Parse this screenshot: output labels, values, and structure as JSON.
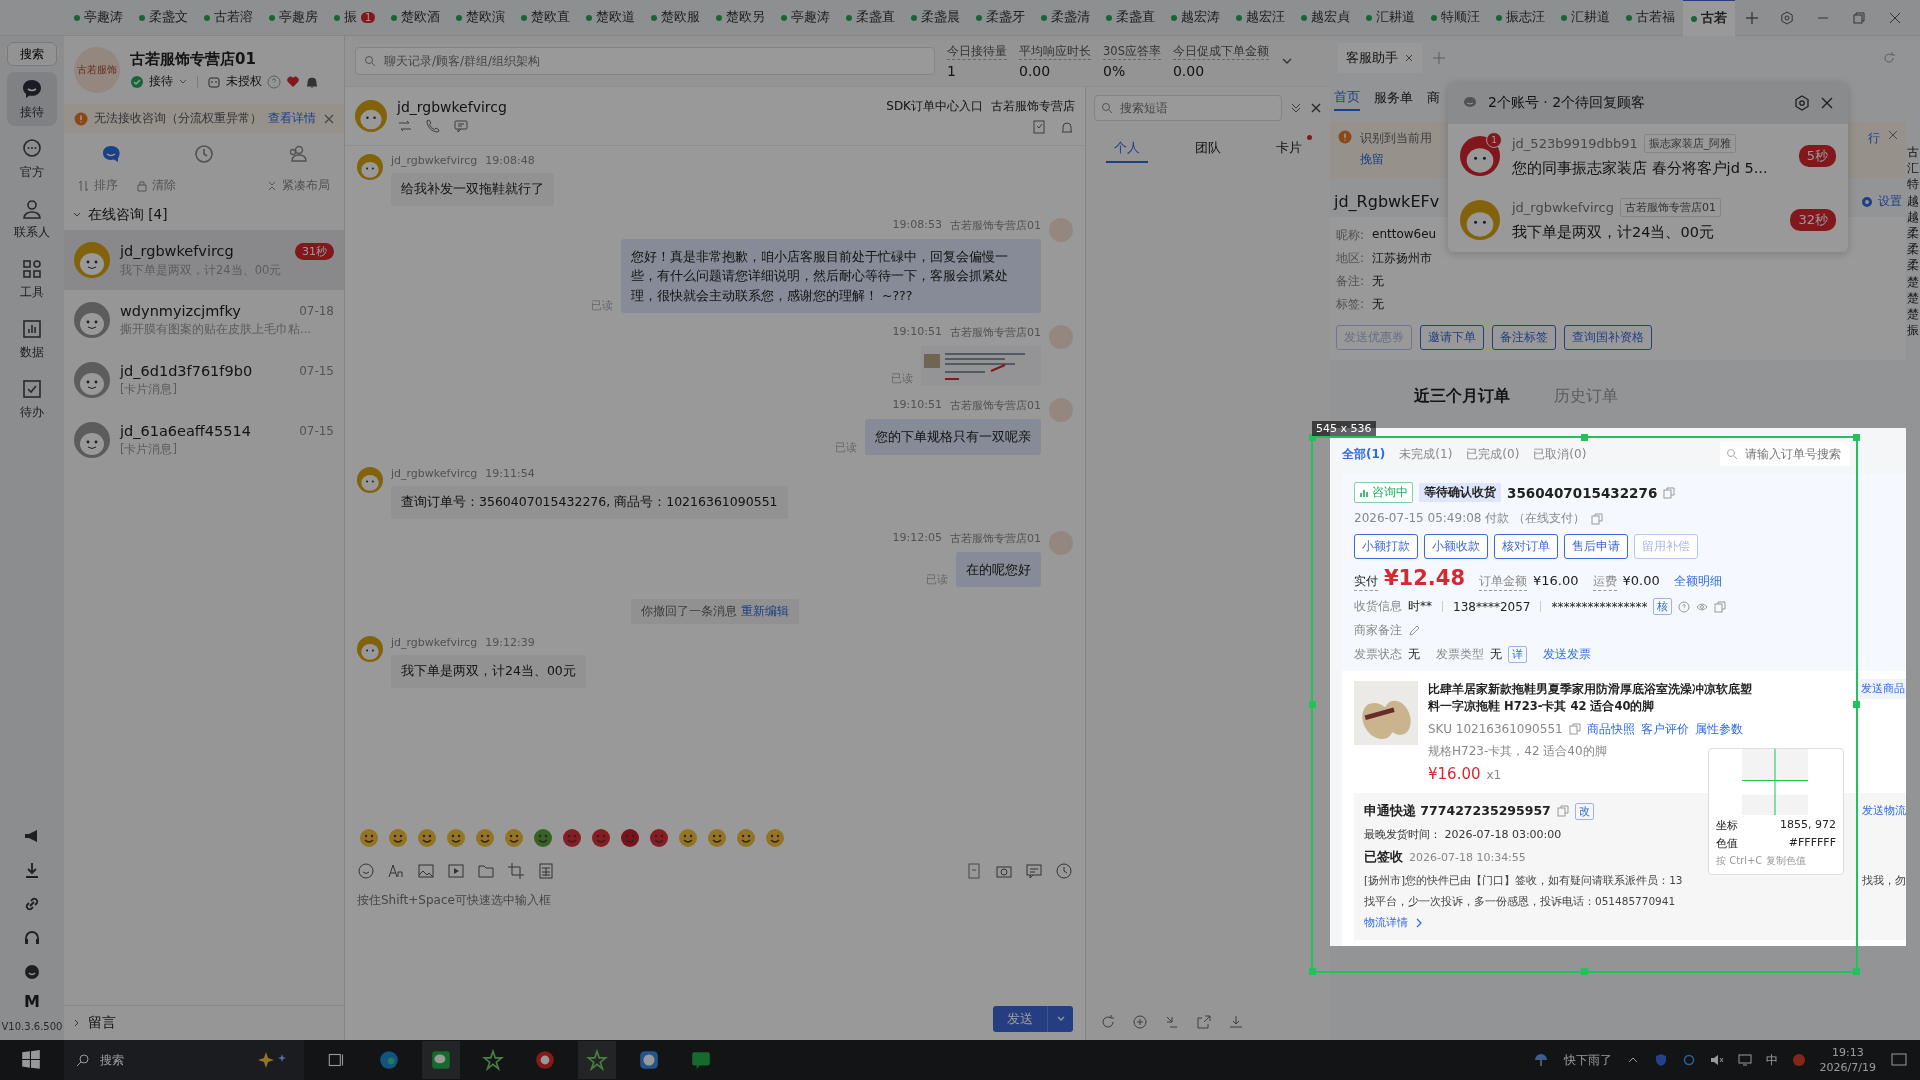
{
  "tabs": [
    {
      "label": "亭趣涛",
      "selected": false
    },
    {
      "label": "柔盏文",
      "selected": false
    },
    {
      "label": "古若溶",
      "selected": false
    },
    {
      "label": "亭趣房",
      "selected": false
    },
    {
      "label": "振",
      "badge": "1",
      "selected": false
    },
    {
      "label": "楚欧酒",
      "selected": false
    },
    {
      "label": "楚欧演",
      "selected": false
    },
    {
      "label": "楚欧直",
      "selected": false
    },
    {
      "label": "楚欧道",
      "selected": false
    },
    {
      "label": "楚欧服",
      "selected": false
    },
    {
      "label": "楚欧另",
      "selected": false
    },
    {
      "label": "亭趣涛",
      "selected": false
    },
    {
      "label": "柔盏直",
      "selected": false
    },
    {
      "label": "柔盏晨",
      "selected": false
    },
    {
      "label": "柔盏牙",
      "selected": false
    },
    {
      "label": "柔盏清",
      "selected": false
    },
    {
      "label": "柔盏直",
      "selected": false
    },
    {
      "label": "越宏涛",
      "selected": false
    },
    {
      "label": "越宏汪",
      "selected": false
    },
    {
      "label": "越宏貞",
      "selected": false
    },
    {
      "label": "汇耕道",
      "selected": false
    },
    {
      "label": "特顺汪",
      "selected": false
    },
    {
      "label": "振志汪",
      "selected": false
    },
    {
      "label": "汇耕道",
      "selected": false
    },
    {
      "label": "古若福",
      "selected": false
    },
    {
      "label": "古若",
      "selected": true
    }
  ],
  "rail": {
    "search_label": "搜索",
    "items": [
      {
        "kind": "chat",
        "label": "接待",
        "selected": true
      },
      {
        "kind": "official",
        "label": "官方",
        "selected": false
      },
      {
        "kind": "contacts",
        "label": "联系人",
        "selected": false
      },
      {
        "kind": "tools",
        "label": "工具",
        "selected": false
      },
      {
        "kind": "data",
        "label": "数据",
        "selected": false
      },
      {
        "kind": "todo",
        "label": "待办",
        "selected": false
      }
    ],
    "m_label": "M",
    "version": "V10.3.6.500"
  },
  "store": {
    "avatar_text": "古若服饰",
    "name": "古若服饰专营店01",
    "status": "接待",
    "auth": "未授权"
  },
  "alert": {
    "text": "无法接收咨询（分流权重异常）",
    "link": "查看详情"
  },
  "contact_tabs": [
    {
      "kind": "chat",
      "selected": true
    },
    {
      "kind": "history",
      "selected": false
    },
    {
      "kind": "group",
      "selected": false
    }
  ],
  "actions": [
    {
      "kind": "sort",
      "label": "排序"
    },
    {
      "kind": "clear",
      "label": "清除"
    },
    {
      "kind": "compact",
      "label": "紧凑布局"
    }
  ],
  "group": {
    "label": "在线咨询 [4]",
    "expanded": true
  },
  "contacts": [
    {
      "name": "jd_rgbwkefvircg",
      "preview": "我下单是两双，计24当、00元",
      "timer": "31秒",
      "kind": "gold",
      "selected": true
    },
    {
      "name": "wdynmyizcjmfky",
      "preview": "撕开膜有图案的贴在皮肤上毛巾粘...",
      "time": "07-18",
      "kind": "gray",
      "selected": false
    },
    {
      "name": "jd_6d1d3f761f9b0",
      "preview": "[卡片消息]",
      "time": "07-15",
      "kind": "gray",
      "selected": false
    },
    {
      "name": "jd_61a6eaff45514",
      "preview": "[卡片消息]",
      "time": "07-15",
      "kind": "gray",
      "selected": false
    }
  ],
  "footer_group": {
    "label": "留言",
    "expanded": false
  },
  "top_search": {
    "placeholder": "聊天记录/顾客/群组/组织架构"
  },
  "stats": [
    {
      "label": "今日接待量",
      "value": "1"
    },
    {
      "label": "平均响应时长",
      "value": "0.00"
    },
    {
      "label": "30S应答率",
      "value": "0%"
    },
    {
      "label": "今日促成下单金额",
      "value": "0.00"
    }
  ],
  "chat": {
    "name": "jd_rgbwkefvircg",
    "links": [
      "SDK订单中心入口",
      "古若服饰专营店"
    ],
    "messages": [
      {
        "kind": "in",
        "sender": "jd_rgbwkefvircg",
        "time": "19:08:48",
        "text": "给我补发一双拖鞋就行了"
      },
      {
        "kind": "out",
        "sender": "古若服饰专营店01",
        "time": "19:08:53",
        "text": "您好！真是非常抱歉，咱小店客服目前处于忙碌中，回复会偏慢一些，有什么问题请您详细说明，然后耐心等待一下，客服会抓紧处理，很快就会主动联系您，感谢您的理解！ ~???",
        "read": "已读"
      },
      {
        "kind": "image",
        "sender": "古若服饰专营店01",
        "time": "19:10:51",
        "read": "已读"
      },
      {
        "kind": "out",
        "sender": "古若服饰专营店01",
        "time": "19:10:51",
        "text": "您的下单规格只有一双呢亲",
        "read": "已读"
      },
      {
        "kind": "in",
        "sender": "jd_rgbwkefvircg",
        "time": "19:11:54",
        "text": "查询订单号：3560407015432276, 商品号：10216361090551"
      },
      {
        "kind": "out",
        "sender": "古若服饰专营店01",
        "time": "19:12:05",
        "text": "在的呢您好",
        "read": "已读"
      },
      {
        "kind": "recall",
        "text": "你撤回了一条消息",
        "link": "重新编辑"
      },
      {
        "kind": "in",
        "sender": "jd_rgbwkefvircg",
        "time": "19:12:39",
        "text": "我下单是两双，计24当、00元"
      }
    ],
    "input_placeholder": "按住Shift+Space可快速选中输入框",
    "send_label": "发送"
  },
  "phrases": {
    "placeholder": "搜索短语",
    "tabs": [
      {
        "label": "个人",
        "selected": true,
        "dot": false
      },
      {
        "label": "团队",
        "selected": false,
        "dot": false
      },
      {
        "label": "卡片",
        "selected": false,
        "dot": true
      }
    ]
  },
  "assistant": {
    "tab": "客服助手",
    "subtabs": [
      {
        "label": "首页",
        "selected": true
      },
      {
        "label": "服务单",
        "selected": false
      },
      {
        "label": "商",
        "selected": false
      }
    ],
    "banner": {
      "text": "识别到当前用",
      "tail": "行",
      "link": "挽留"
    },
    "customer_name": "jd_RgbwkEFv",
    "setting_label": "设置",
    "info": [
      {
        "label": "昵称:",
        "value": "enttow6eu"
      },
      {
        "label": "地区:",
        "value": "江苏扬州市"
      },
      {
        "label": "备注:",
        "value": "无"
      },
      {
        "label": "标签:",
        "value": "无"
      }
    ],
    "buttons": [
      {
        "label": "发送优惠券",
        "disabled": true
      },
      {
        "label": "邀请下单",
        "disabled": false
      },
      {
        "label": "备注标签",
        "disabled": false
      },
      {
        "label": "查询国补资格",
        "disabled": false
      }
    ],
    "order_tabs": [
      {
        "label": "近三个月订单",
        "selected": true
      },
      {
        "label": "历史订单",
        "selected": false
      }
    ],
    "filters": [
      {
        "label": "全部(1)",
        "selected": true
      },
      {
        "label": "未完成(1)",
        "selected": false
      },
      {
        "label": "已完成(0)",
        "selected": false
      },
      {
        "label": "已取消(0)",
        "selected": false
      }
    ],
    "order_search_placeholder": "请输入订单号搜索",
    "order": {
      "tags": [
        {
          "kind": "consult",
          "label": "咨询中"
        },
        {
          "kind": "status",
          "label": "等待确认收货"
        }
      ],
      "number": "3560407015432276",
      "paid_time": "2026-07-15 05:49:08 付款 （在线支付）",
      "actions": [
        {
          "label": "小额打款",
          "disabled": false
        },
        {
          "label": "小额收款",
          "disabled": false
        },
        {
          "label": "核对订单",
          "disabled": false
        },
        {
          "label": "售后申请",
          "disabled": false
        },
        {
          "label": "留用补偿",
          "disabled": true
        }
      ],
      "paid_label": "实付",
      "paid": "¥12.48",
      "amount_label": "订单金额",
      "amount": "¥16.00",
      "freight_label": "运费",
      "freight": "¥0.00",
      "detail_link": "全额明细",
      "receiver_label": "收货信息",
      "receiver": "时**",
      "phone": "138****2057",
      "address": "****************",
      "verify": "核",
      "note_label": "商家备注",
      "invoice_status_label": "发票状态",
      "invoice_status": "无",
      "invoice_type_label": "发票类型",
      "invoice_type": "无",
      "invoice_detail": "详",
      "invoice_link": "发送发票",
      "product": {
        "title": "比肆羊居家新款拖鞋男夏季家用防滑厚底浴室洗澡冲凉软底塑料一字凉拖鞋 H723-卡其 42 适合40的脚",
        "send": "发送商品",
        "sku": "SKU 10216361090551",
        "links": [
          "商品快照",
          "客户评价",
          "属性参数"
        ],
        "spec": "规格H723-卡其，42 适合40的脚",
        "price": "¥16.00",
        "qty": "x1"
      },
      "logistics": {
        "carrier": "申通快递 777427235295957",
        "edit": "改",
        "send": "发送物流",
        "deadline": "最晚发货时间：  2026-07-18 03:00:00",
        "state": "已签收",
        "state_time": "2026-07-18 10:34:55",
        "line1": "[扬州市]您的快件已由【门口】签收，如有疑问请联系派件员：13",
        "line1_tail": "找我，勿",
        "line2": "找平台，少一次投诉，多一份感恩，投诉电话：051485770941",
        "detail_link": "物流详情"
      }
    }
  },
  "edge_chars": [
    "古",
    "汇",
    "特",
    "越",
    "越",
    "柔",
    "柔",
    "柔",
    "楚",
    "楚",
    "楚",
    "振"
  ],
  "popup": {
    "title": "2个账号 · 2个待回复顾客",
    "items": [
      {
        "name": "jd_523b9919dbb91",
        "tag": "振志家装店_阿雅",
        "text": "您的同事振志家装店 春分将客户jd 5...",
        "timer": "5秒",
        "badge": "1",
        "kind": "red"
      },
      {
        "name": "jd_rgbwkefvircg",
        "tag": "古若服饰专营店01",
        "text": "我下单是两双，计24当、00元",
        "timer": "32秒",
        "kind": "gold"
      }
    ]
  },
  "selection": {
    "size_label": "545 x 536"
  },
  "picker": {
    "coord_label": "坐标",
    "coord": "1855, 972",
    "color_label": "色值",
    "color_value": "#FFFFFF",
    "hint": "按 Ctrl+C 复制色值"
  },
  "taskbar": {
    "search": "搜索",
    "weather": "快下雨了",
    "ime": "中",
    "time": "19:13",
    "date": "2026/7/19"
  }
}
